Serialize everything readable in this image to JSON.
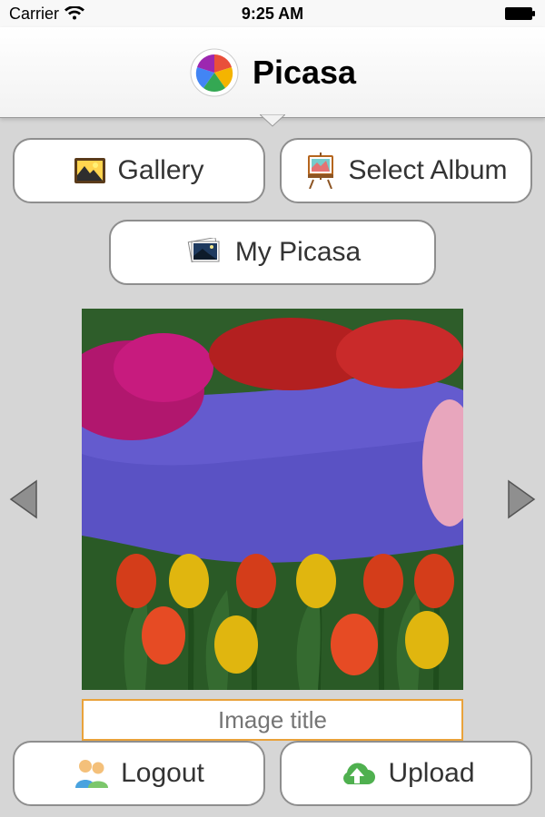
{
  "status": {
    "carrier": "Carrier",
    "time": "9:25 AM"
  },
  "header": {
    "title": "Picasa"
  },
  "buttons": {
    "gallery": "Gallery",
    "selectAlbum": "Select Album",
    "myPicasa": "My Picasa",
    "logout": "Logout",
    "upload": "Upload"
  },
  "image": {
    "titlePlaceholder": "Image title"
  }
}
